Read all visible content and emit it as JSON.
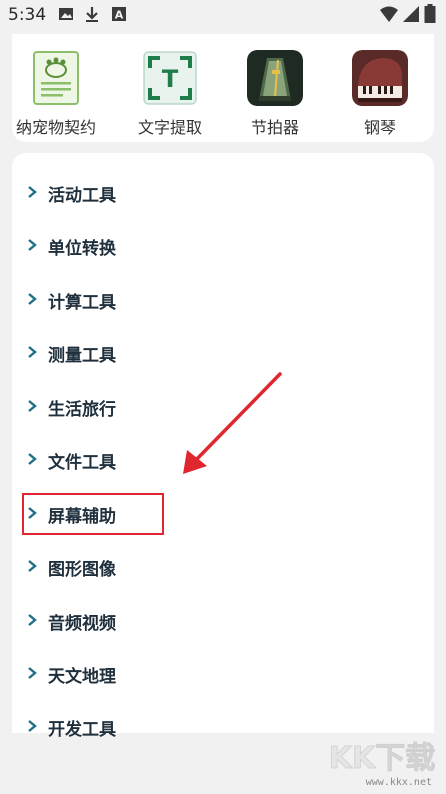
{
  "status_bar": {
    "time": "5:34",
    "left_icons": [
      "image-icon",
      "download-icon",
      "font-icon"
    ],
    "right_icons": [
      "wifi-icon",
      "signal-icon",
      "battery-icon"
    ]
  },
  "apps": [
    {
      "label": "纳宠物契约",
      "icon": "pet-contract-icon"
    },
    {
      "label": "文字提取",
      "icon": "text-extract-icon"
    },
    {
      "label": "节拍器",
      "icon": "metronome-icon"
    },
    {
      "label": "钢琴",
      "icon": "piano-icon"
    }
  ],
  "categories": [
    {
      "label": "活动工具"
    },
    {
      "label": "单位转换"
    },
    {
      "label": "计算工具"
    },
    {
      "label": "测量工具"
    },
    {
      "label": "生活旅行"
    },
    {
      "label": "文件工具"
    },
    {
      "label": "屏幕辅助"
    },
    {
      "label": "图形图像"
    },
    {
      "label": "音频视频"
    },
    {
      "label": "天文地理"
    },
    {
      "label": "开发工具"
    }
  ],
  "annotation": {
    "highlight_color": "#e0262e",
    "highlighted_item": "屏幕辅助"
  },
  "watermark": {
    "url": "www.kkx.net",
    "logo": "kkx-download-logo"
  },
  "colors": {
    "chevron": "#1f6f86",
    "text": "#1f2f3c",
    "card": "#ffffff",
    "background": "#f1f1f1"
  }
}
